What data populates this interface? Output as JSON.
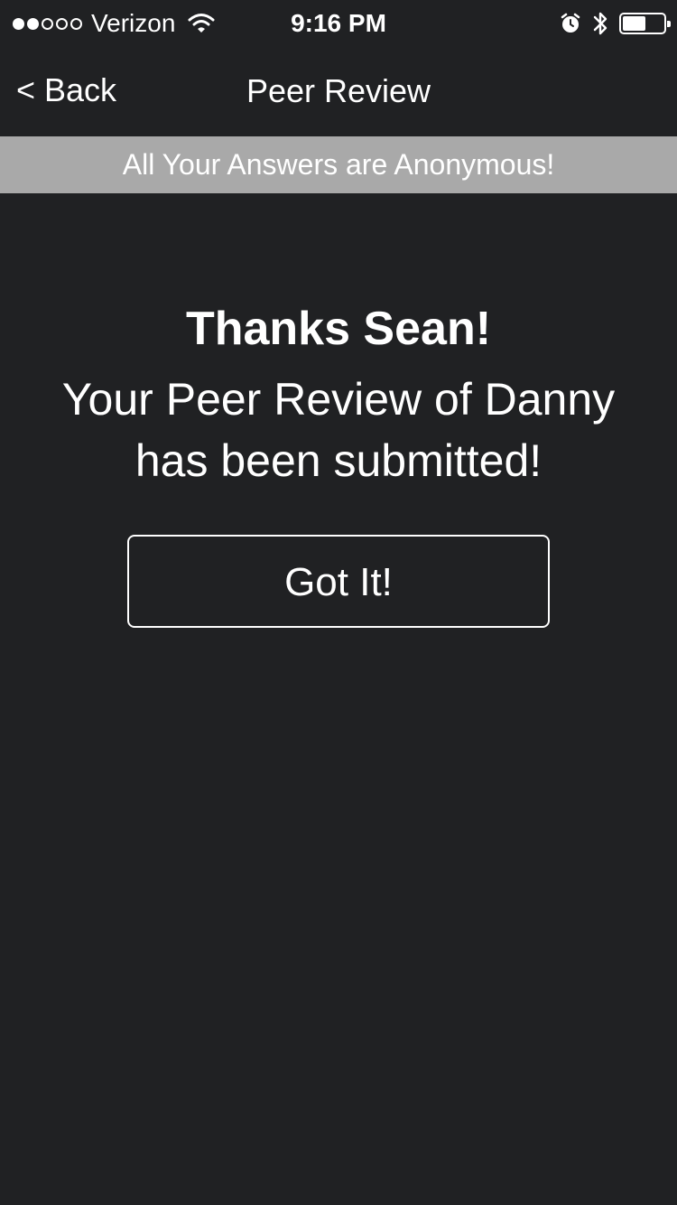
{
  "status_bar": {
    "signal_filled": 2,
    "signal_total": 5,
    "carrier": "Verizon",
    "time": "9:16 PM",
    "battery_level": 0.6,
    "icons": [
      "signal-icon",
      "wifi-icon",
      "alarm-icon",
      "bluetooth-icon",
      "battery-icon"
    ]
  },
  "nav": {
    "back_label": "< Back",
    "title": "Peer Review"
  },
  "banner": {
    "text": "All Your Answers are Anonymous!"
  },
  "main": {
    "heading": "Thanks Sean!",
    "message": "Your Peer Review of Danny has been submitted!",
    "button_label": "Got It!"
  },
  "colors": {
    "background": "#202123",
    "banner": "#a9a9a9",
    "text": "#ffffff"
  }
}
